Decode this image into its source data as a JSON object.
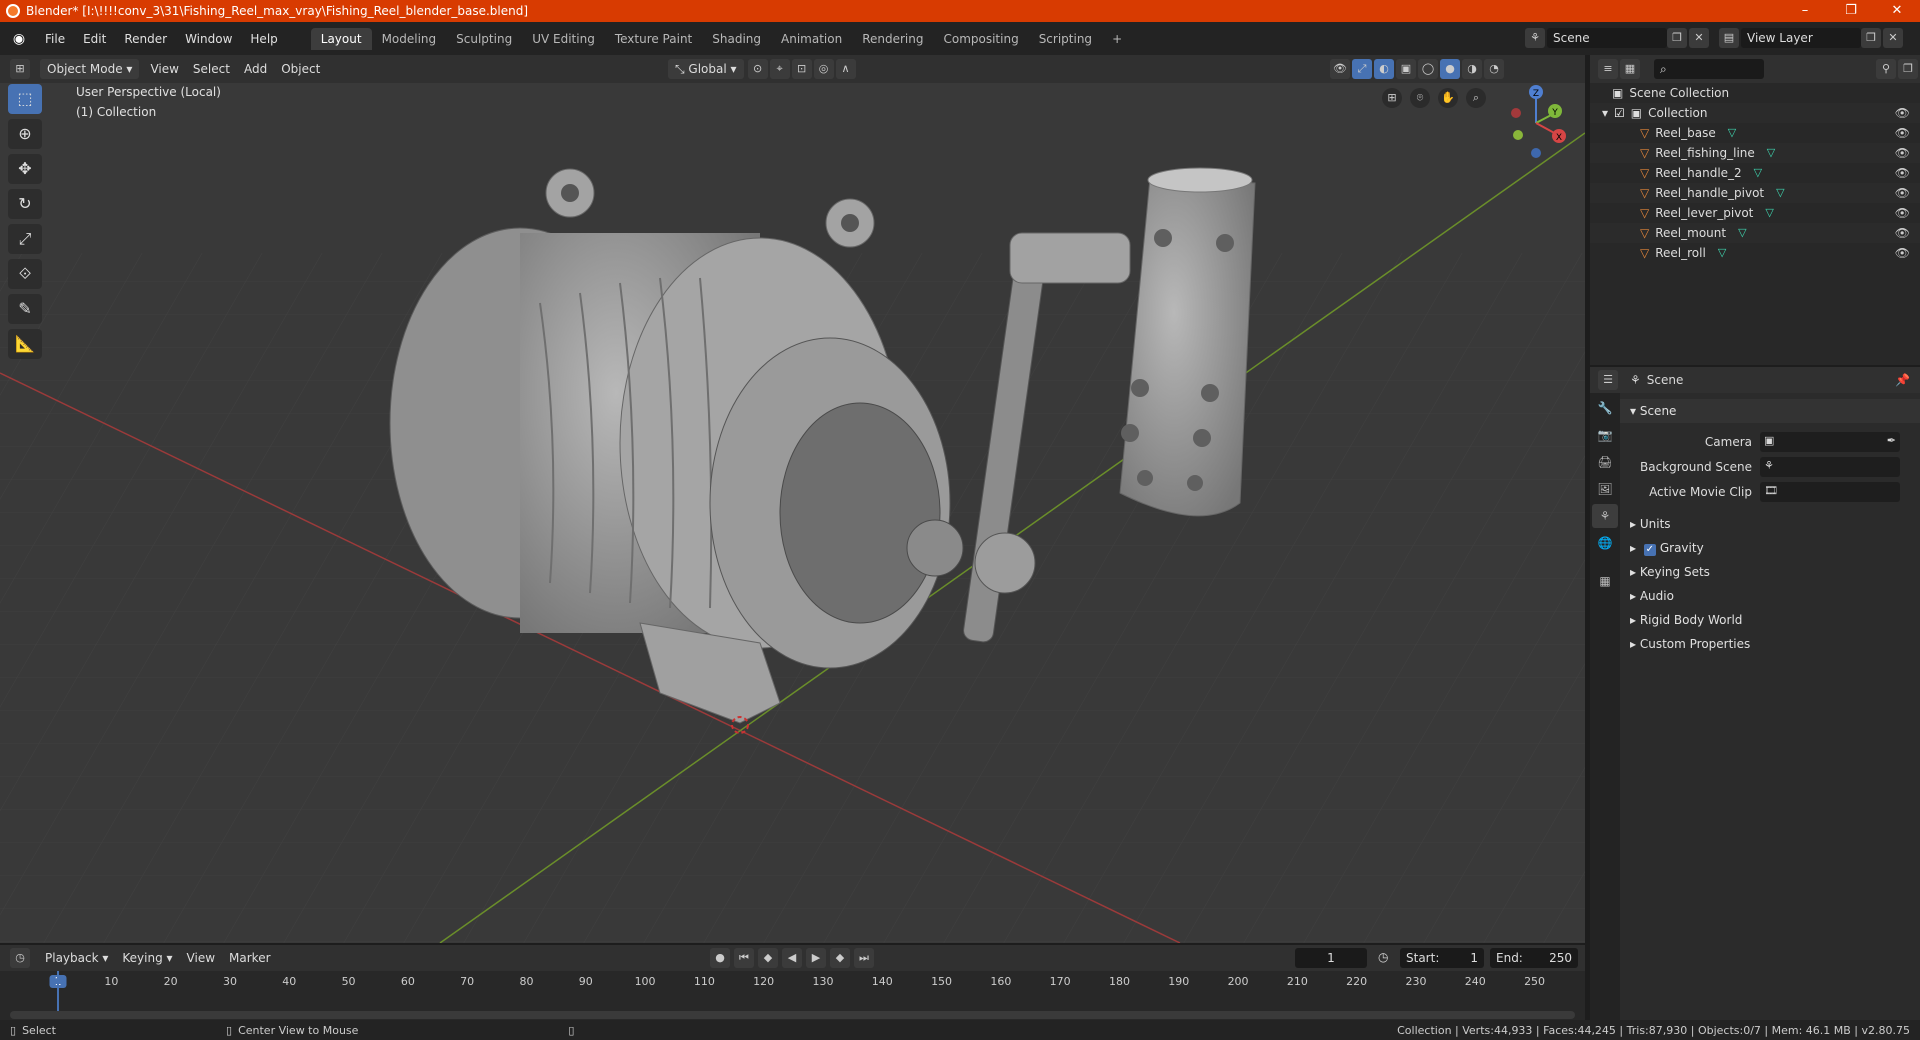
{
  "window": {
    "title": "Blender* [I:\\!!!!conv_3\\31\\Fishing_Reel_max_vray\\Fishing_Reel_blender_base.blend]",
    "minimize": "–",
    "maximize": "❐",
    "close": "✕"
  },
  "topbar": {
    "menus": [
      "File",
      "Edit",
      "Render",
      "Window",
      "Help"
    ],
    "workspaces": [
      "Layout",
      "Modeling",
      "Sculpting",
      "UV Editing",
      "Texture Paint",
      "Shading",
      "Animation",
      "Rendering",
      "Compositing",
      "Scripting"
    ],
    "active_workspace": "Layout",
    "add_workspace": "+",
    "scene": "Scene",
    "view_layer": "View Layer"
  },
  "viewport_header": {
    "mode": "Object Mode",
    "menus": [
      "View",
      "Select",
      "Add",
      "Object"
    ],
    "orientation": "Global"
  },
  "viewport": {
    "perspective_label": "User Perspective (Local)",
    "collection_label": "(1) Collection",
    "gizmo": {
      "x": "X",
      "y": "Y",
      "z": "Z"
    }
  },
  "toolbar": {
    "tools": [
      "select-box-icon",
      "cursor-icon",
      "move-icon",
      "rotate-icon",
      "scale-icon",
      "transform-icon",
      "annotate-icon",
      "measure-icon"
    ]
  },
  "outliner": {
    "search_placeholder": "",
    "scene_collection": "Scene Collection",
    "collection": "Collection",
    "objects": [
      "Reel_base",
      "Reel_fishing_line",
      "Reel_handle_2",
      "Reel_handle_pivot",
      "Reel_lever_pivot",
      "Reel_mount",
      "Reel_roll"
    ]
  },
  "properties": {
    "context": "Scene",
    "sections": {
      "scene": "Scene",
      "camera_label": "Camera",
      "background_scene_label": "Background Scene",
      "active_movie_clip_label": "Active Movie Clip",
      "units": "Units",
      "gravity": "Gravity",
      "keying_sets": "Keying Sets",
      "audio": "Audio",
      "rigid_body_world": "Rigid Body World",
      "custom_properties": "Custom Properties"
    },
    "gravity_checked": true
  },
  "timeline": {
    "menus": [
      "Playback",
      "Keying",
      "View",
      "Marker"
    ],
    "current_frame": "1",
    "start_label": "Start:",
    "start": "1",
    "end_label": "End:",
    "end": "250",
    "ruler": [
      "1",
      "10",
      "20",
      "30",
      "40",
      "50",
      "60",
      "70",
      "80",
      "90",
      "100",
      "110",
      "120",
      "130",
      "140",
      "150",
      "160",
      "170",
      "180",
      "190",
      "200",
      "210",
      "220",
      "230",
      "240",
      "250"
    ]
  },
  "statusbar": {
    "select": "Select",
    "center_view": "Center View to Mouse",
    "stats": "Collection | Verts:44,933 | Faces:44,245 | Tris:87,930 | Objects:0/7 | Mem: 46.1 MB | v2.80.75"
  },
  "colors": {
    "titlebar": "#d83b01",
    "accent": "#4772b3",
    "x_axis": "#c0403f",
    "y_axis": "#6f9a2c",
    "mesh_icon": "#e3863a",
    "tri_icon": "#3fd6b0"
  }
}
